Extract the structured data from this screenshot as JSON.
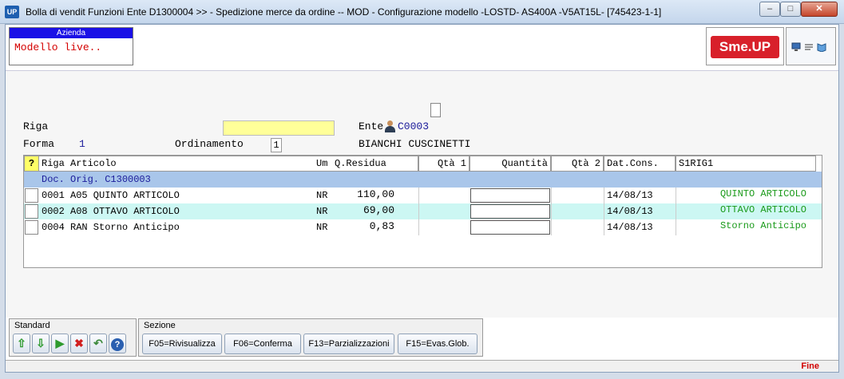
{
  "window": {
    "app_icon": "UP",
    "title": "Bolla di vendit Funzioni Ente D1300004 >> -  Spedizione merce da ordine -- MOD - Configurazione modello -LOSTD- AS400A -V5AT15L- [745423-1-1]",
    "minimize_icon": "minimize-icon",
    "maximize_icon": "maximize-icon",
    "close_icon": "close-icon"
  },
  "azienda": {
    "header": "Azienda",
    "value": "Modello live.."
  },
  "logo": {
    "text": "Sme.UP",
    "color": "#d8202a"
  },
  "form": {
    "riga_label": "Riga",
    "forma_label": "Forma",
    "forma_value": "1",
    "ordinamento_label": "Ordinamento",
    "ordinamento_value": "1",
    "ente_label": "Ente",
    "ente_code": "C0003",
    "ente_name": "BIANCHI CUSCINETTI"
  },
  "grid": {
    "headers": {
      "select": "?",
      "riga_articolo": "Riga Articolo",
      "um": "Um",
      "q_residua": "Q.Residua",
      "qta1": "Qtà 1",
      "quantita": "Quantità",
      "qta2": "Qtà 2",
      "dat_cons": "Dat.Cons.",
      "s1rig1": "S1RIG1"
    },
    "group_label": "Doc. Orig. C1300003",
    "rows": [
      {
        "riga_articolo": "0001 A05 QUINTO ARTICOLO",
        "um": "NR",
        "q_residua": "110,00",
        "dat_cons": "14/08/13",
        "s1rig1": "QUINTO ARTICOLO"
      },
      {
        "riga_articolo": "0002 A08 OTTAVO ARTICOLO",
        "um": "NR",
        "q_residua": "69,00",
        "dat_cons": "14/08/13",
        "s1rig1": "OTTAVO ARTICOLO"
      },
      {
        "riga_articolo": "0004 RAN Storno Anticipo",
        "um": "NR",
        "q_residua": "0,83",
        "dat_cons": "14/08/13",
        "s1rig1": "Storno Anticipo"
      }
    ],
    "group_color": "#a9c6ea",
    "highlight_color": "#ccf7f3"
  },
  "standard": {
    "label": "Standard",
    "buttons": [
      "arrow-up-icon",
      "arrow-down-icon",
      "play-icon",
      "cancel-icon",
      "undo-icon",
      "help-icon"
    ]
  },
  "sezione": {
    "label": "Sezione",
    "f05": "F05=Rivisualizza",
    "f06": "F06=Conferma",
    "f13": "F13=Parzializzazioni",
    "f15": "F15=Evas.Glob."
  },
  "status": {
    "fine": "Fine"
  }
}
